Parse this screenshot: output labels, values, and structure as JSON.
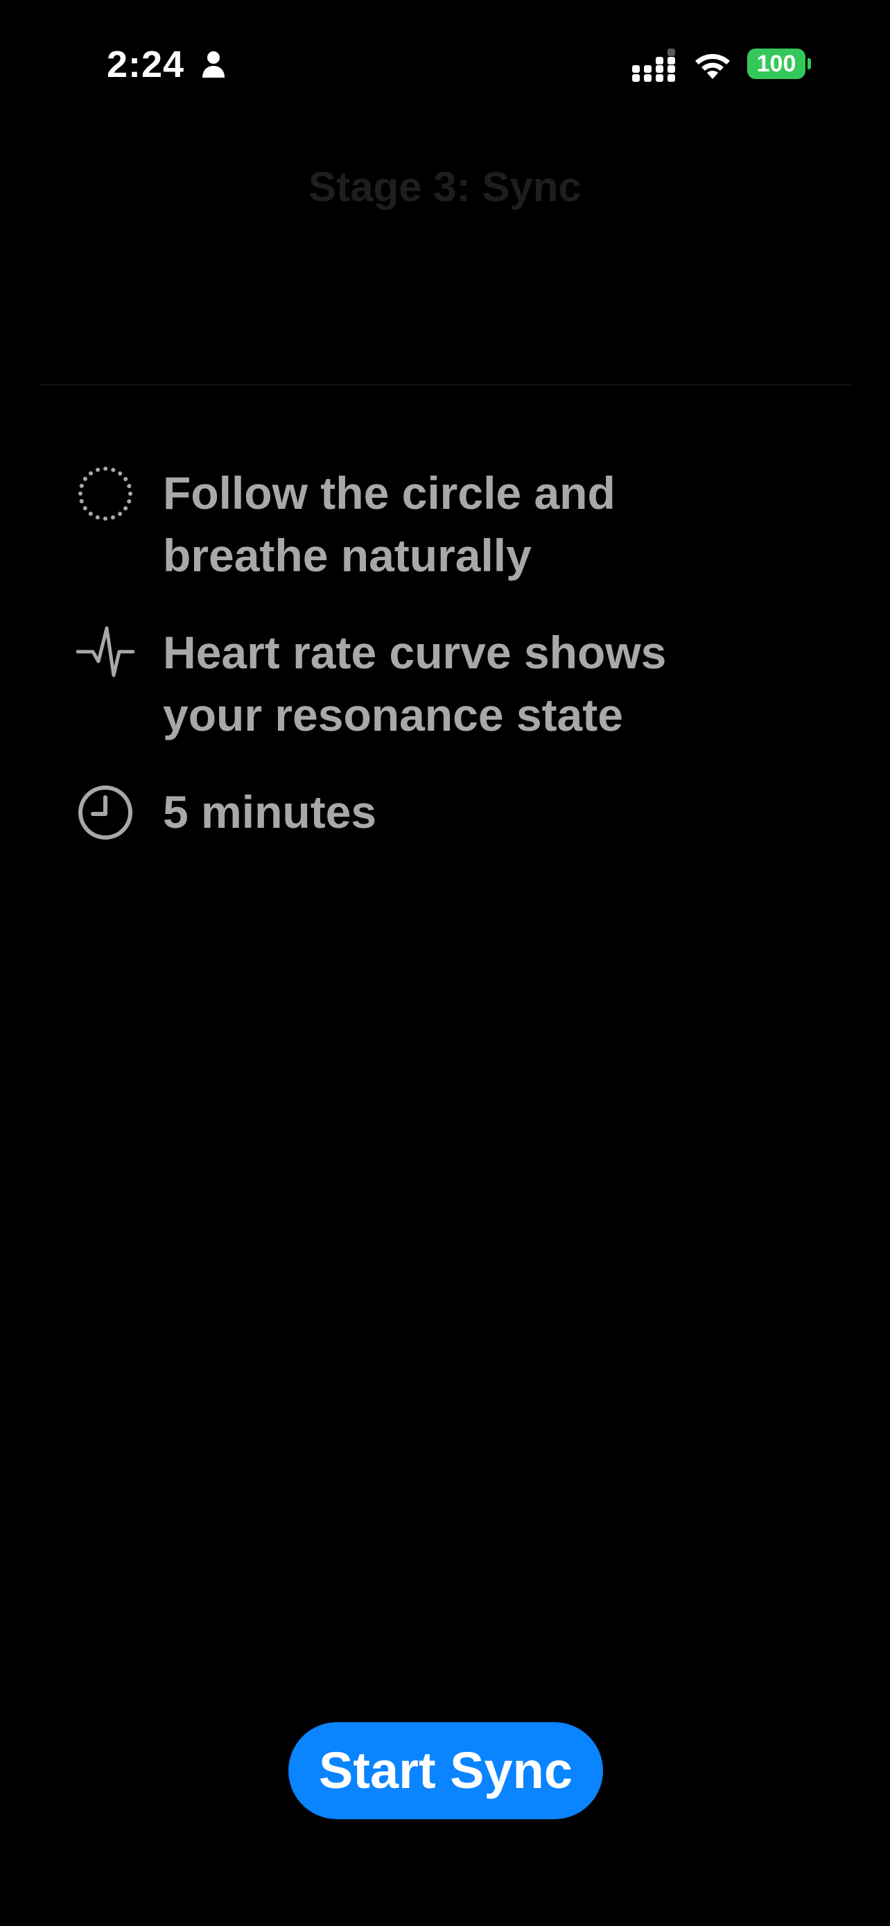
{
  "status_bar": {
    "time": "2:24",
    "battery_level": "100",
    "battery_color": "#34c759",
    "icons": [
      "person-icon",
      "cellular-signal-icon",
      "wifi-icon",
      "battery-icon"
    ]
  },
  "header": {
    "title": "Stage 3: Sync"
  },
  "instructions": [
    {
      "icon": "dotted-circle-icon",
      "text": "Follow the circle and\nbreathe naturally"
    },
    {
      "icon": "heartbeat-icon",
      "text": "Heart rate curve shows\nyour resonance state"
    },
    {
      "icon": "clock-icon",
      "text": "5 minutes"
    }
  ],
  "actions": {
    "start_label": "Start Sync",
    "accent_color": "#0a84ff"
  }
}
